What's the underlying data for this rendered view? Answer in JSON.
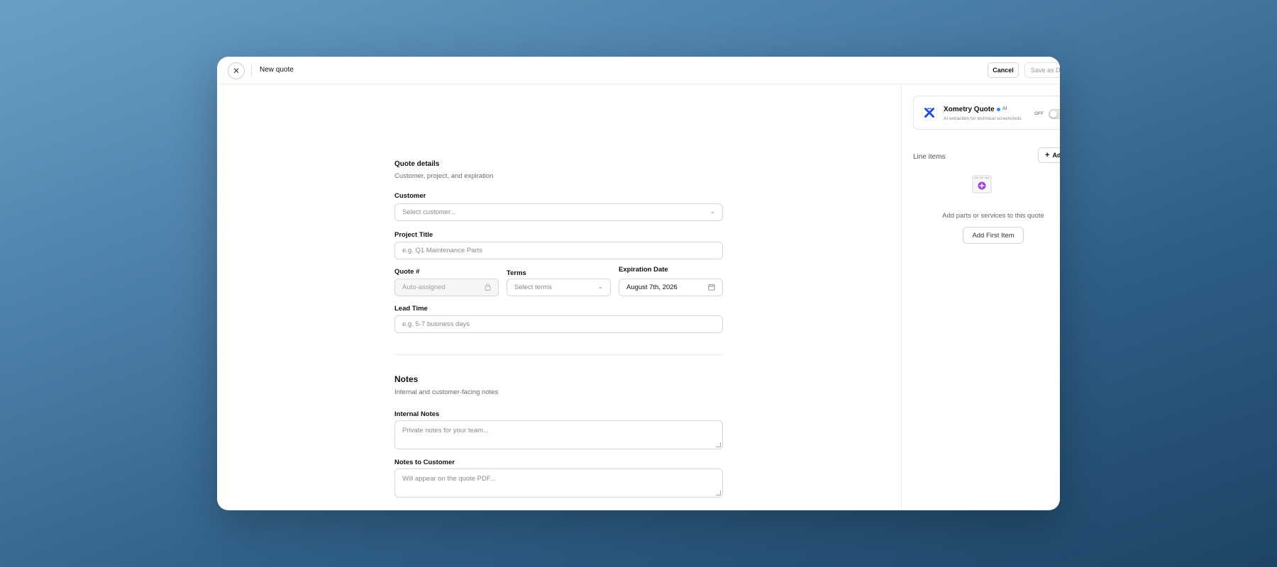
{
  "header": {
    "close_icon": "close-icon",
    "title": "New quote",
    "cancel_label": "Cancel",
    "save_draft_label": "Save as Dra"
  },
  "quote_details": {
    "title": "Quote details",
    "subtitle": "Customer, project, and expiration",
    "customer": {
      "label": "Customer",
      "placeholder": "Select customer..."
    },
    "project_title": {
      "label": "Project Title",
      "placeholder": "e.g. Q1 Maintenance Parts"
    },
    "quote_number": {
      "label": "Quote #",
      "placeholder": "Auto-assigned"
    },
    "terms": {
      "label": "Terms",
      "placeholder": "Select terms"
    },
    "expiration_date": {
      "label": "Expiration Date",
      "value": "August 7th, 2026"
    },
    "lead_time": {
      "label": "Lead Time",
      "placeholder": "e.g. 5-7 business days"
    }
  },
  "notes": {
    "title": "Notes",
    "subtitle": "Internal and customer-facing notes",
    "internal": {
      "label": "Internal Notes",
      "placeholder": "Private notes for your team..."
    },
    "customer": {
      "label": "Notes to Customer",
      "placeholder": "Will appear on the quote PDF..."
    }
  },
  "sidebar": {
    "integration": {
      "name": "Xometry Quote",
      "badge": "AI",
      "description": "AI extraction for technical screenshots",
      "toggle_label": "OFF",
      "toggle_on": false,
      "accent": "#3b82f6"
    },
    "line_items": {
      "label": "Line items",
      "add_label": "Ad",
      "empty_text": "Add parts or services to this quote",
      "add_first_label": "Add First Item"
    }
  },
  "colors": {
    "brand_blue": "#1f4fd6",
    "empty_icon_purple": "#9b3fd9"
  }
}
